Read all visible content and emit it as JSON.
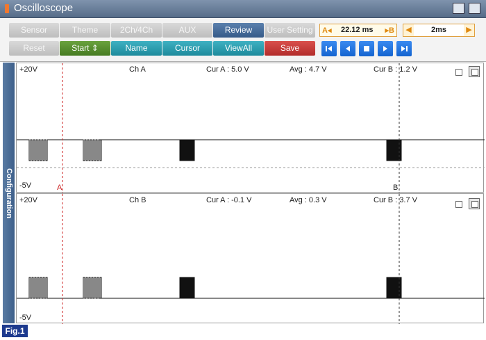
{
  "window": {
    "title": "Oscilloscope"
  },
  "toolbar": {
    "row1": [
      "Sensor",
      "Theme",
      "2Ch/4Ch",
      "AUX",
      "Review",
      "User Setting"
    ],
    "row2": [
      "Reset",
      "Start ⇕",
      "Name",
      "Cursor",
      "ViewAll",
      "Save"
    ],
    "cursor_time": {
      "a_label": "A◂",
      "value": "22.12 ms",
      "b_label": "▸B"
    },
    "time_div": {
      "value": "2ms",
      "left_arrow": "◀",
      "right_arrow": "▶"
    },
    "playback": [
      "first-icon",
      "prev-icon",
      "stop-icon",
      "next-icon",
      "last-icon"
    ]
  },
  "sidebar": {
    "label": "Configuration"
  },
  "channels": [
    {
      "name": "Ch A",
      "top_label": "+20V",
      "bottom_label": "-5V",
      "cur_a": "Cur A : 5.0 V",
      "avg": "Avg : 4.7 V",
      "cur_b": "Cur B : 1.2 V",
      "cursor_a_marker": "A",
      "cursor_b_marker": "B"
    },
    {
      "name": "Ch B",
      "top_label": "+20V",
      "bottom_label": "-5V",
      "cur_a": "Cur A : -0.1 V",
      "avg": "Avg : 0.3 V",
      "cur_b": "Cur B : 3.7 V"
    }
  ],
  "figure_label": "Fig.1",
  "colors": {
    "accent": "#355a88",
    "cursor_line": "#cc2222",
    "trace": "#111111"
  }
}
